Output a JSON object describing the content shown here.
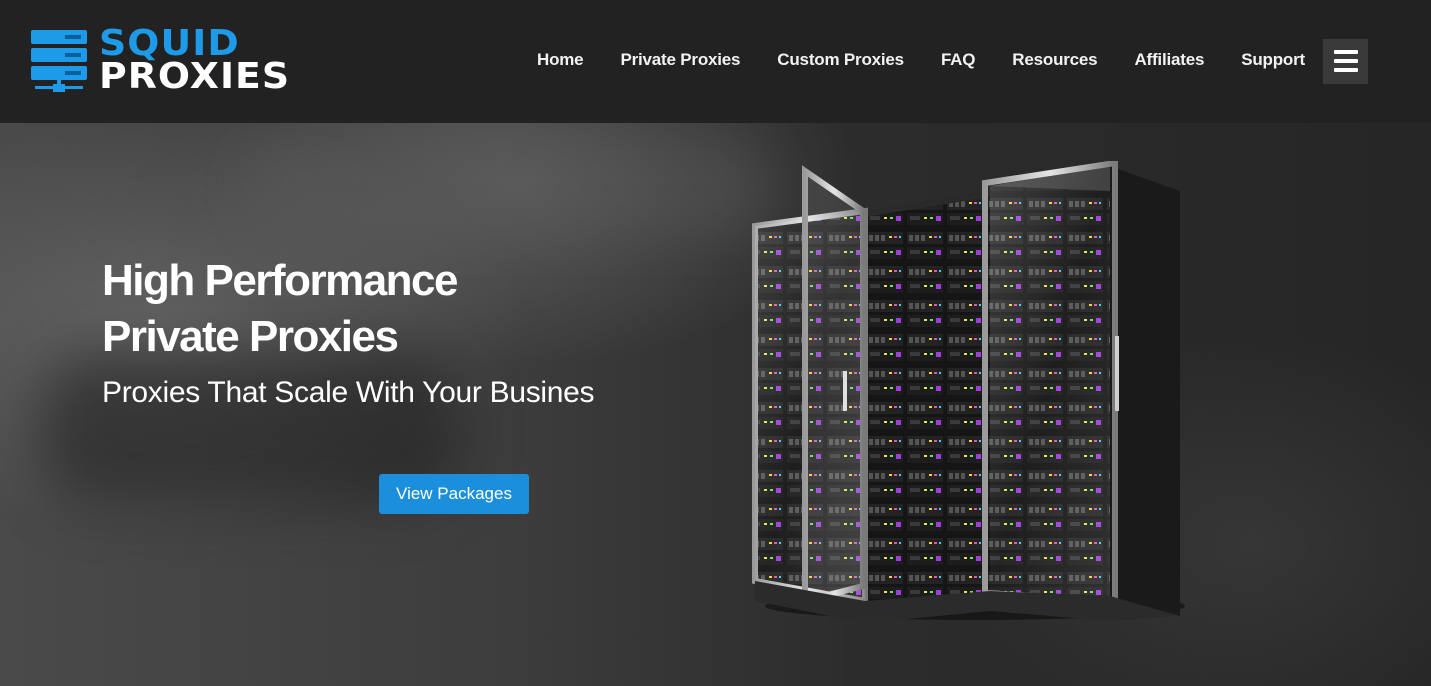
{
  "brand": {
    "line1": "SQUID",
    "line2": "PROXIES",
    "colors": {
      "accent": "#1e9be8",
      "header_bg": "#222222"
    }
  },
  "nav": {
    "items": [
      {
        "label": "Home"
      },
      {
        "label": "Private Proxies"
      },
      {
        "label": "Custom Proxies"
      },
      {
        "label": "FAQ"
      },
      {
        "label": "Resources"
      },
      {
        "label": "Affiliates"
      },
      {
        "label": "Support"
      }
    ],
    "menu_icon": "hamburger-icon"
  },
  "hero": {
    "title_line1": "High Performance",
    "title_line2": "Private Proxies",
    "subtitle": "Proxies That Scale With Your Busines",
    "cta_label": "View Packages",
    "cta_color": "#1b8fdc",
    "image": "server-racks-illustration"
  }
}
